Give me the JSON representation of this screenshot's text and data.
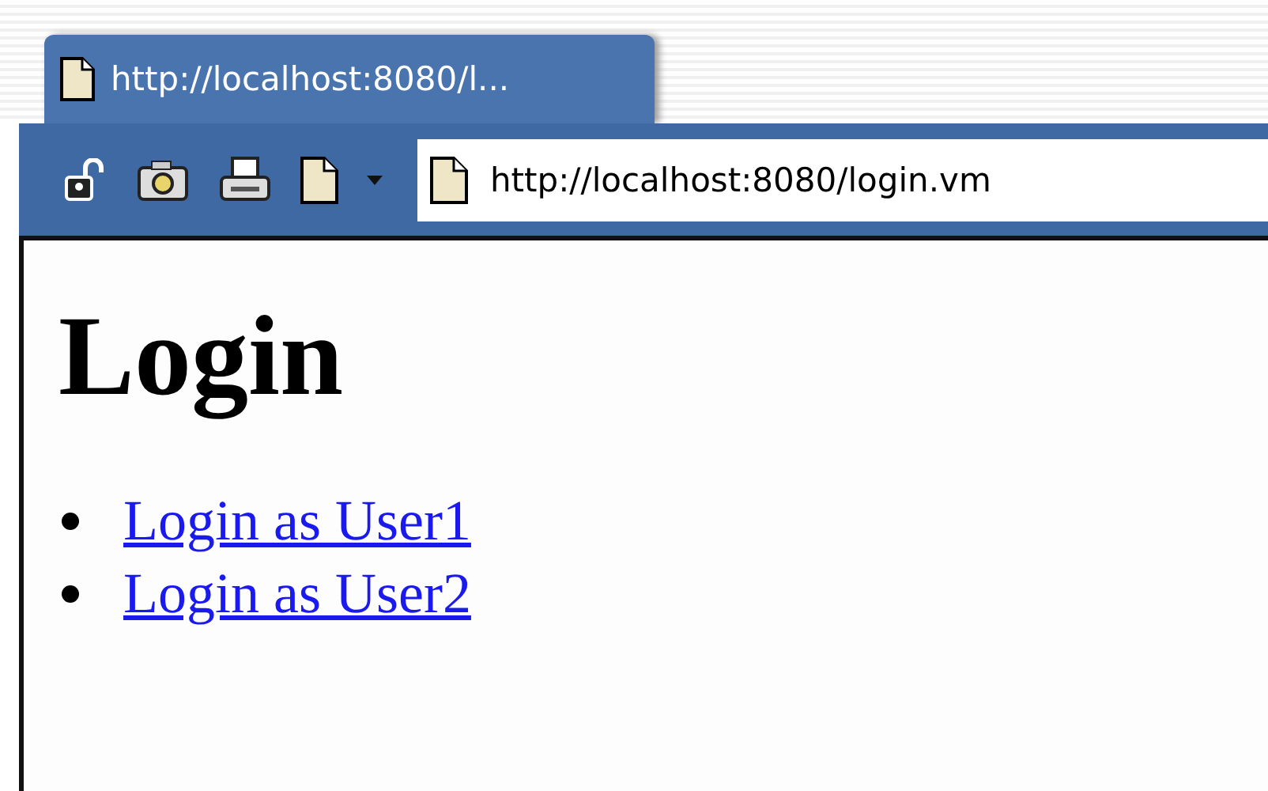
{
  "tab": {
    "title": "http://localhost:8080/l..."
  },
  "address_bar": {
    "value": "http://localhost:8080/login.vm"
  },
  "page": {
    "heading": "Login",
    "links": [
      {
        "label": "Login as User1"
      },
      {
        "label": "Login as User2"
      }
    ]
  }
}
